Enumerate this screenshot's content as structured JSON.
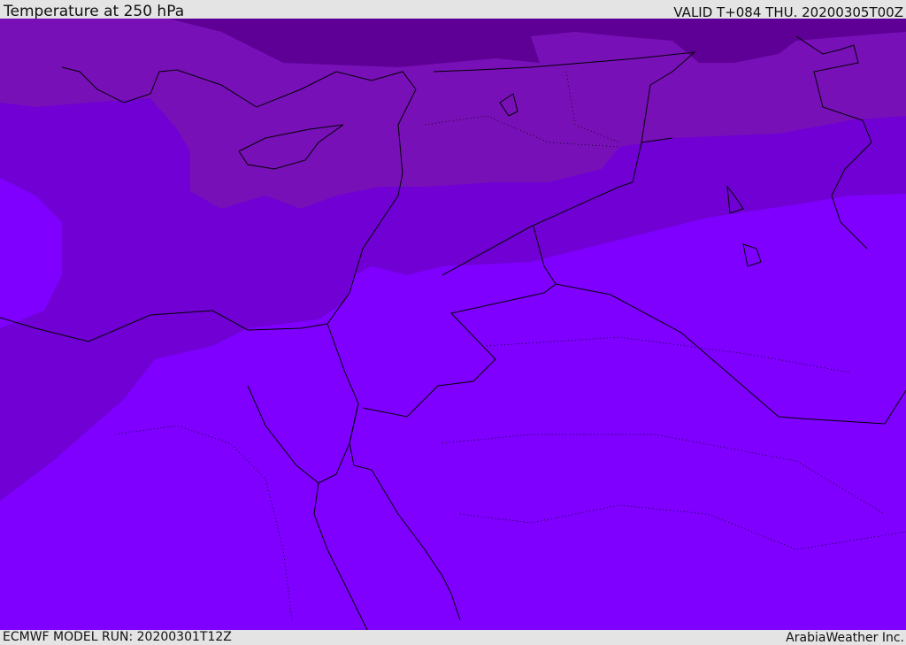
{
  "header": {
    "title": "Temperature at 250 hPa",
    "valid": "VALID T+084 THU. 20200305T00Z"
  },
  "footer": {
    "model_run": "ECMWF MODEL RUN: 20200301T12Z",
    "credit": "ArabiaWeather Inc."
  },
  "colors": {
    "band_coldest": "#5e0096",
    "band_cold": "#7810b8",
    "band_mid": "#7000d4",
    "band_warm": "#7f00ff",
    "coastline": "#000000"
  }
}
